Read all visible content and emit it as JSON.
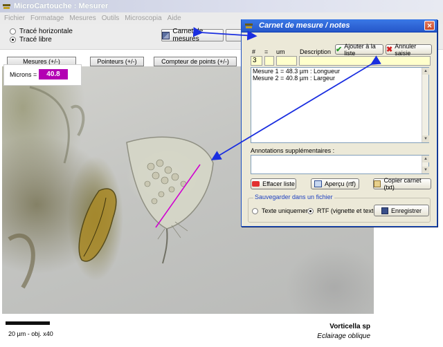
{
  "app": {
    "title": "MicroCartouche : Mesurer",
    "menu": [
      "Fichier",
      "Formatage",
      "Mesures",
      "Outils",
      "Microscopia",
      "Aide"
    ]
  },
  "toolbar": {
    "trace_horizontal": "Tracé horizontale",
    "trace_libre": "Tracé libre",
    "selected_mode": "trace_libre",
    "carnet_button": "Carnet de mesures"
  },
  "tabs": {
    "mesures": "Mesures (+/-)",
    "pointeurs": "Pointeurs (+/-)",
    "compteur": "Compteur de points (+/-)"
  },
  "measurement": {
    "label": "Microns =",
    "value": "40.8"
  },
  "image": {
    "scale_label": "20 µm - obj. x40",
    "species": "Vorticella sp",
    "lighting": "Eclairage oblique"
  },
  "dialog": {
    "title": "Carnet de mesure / notes",
    "headers": {
      "num": "#",
      "eq": "=",
      "unit": "um",
      "description": "Description"
    },
    "fields": {
      "num": "3",
      "eq": "",
      "unit": "",
      "description": ""
    },
    "add_button": "Ajouter à la liste",
    "cancel_button": "Annuler saisie",
    "entries": [
      "Mesure 1 = 48.3 µm : Longueur",
      "Mesure 2 = 40.8 µm : Largeur"
    ],
    "annotations_label": "Annotations supplémentaires :",
    "clear_button": "Effacer liste",
    "preview_button": "Aperçu (rtf)",
    "copy_button": "Copier carnet (txt)",
    "save_group_label": "Sauvegarder dans un fichier",
    "save_text_only": "Texte uniquement",
    "save_rtf": "RTF (vignette et texte)",
    "save_selected": "rtf",
    "save_button": "Enregistrer"
  },
  "colors": {
    "measure_highlight": "#b300b3",
    "annotation_arrow": "#1a2ee0",
    "dialog_title": "#2657c9",
    "input_fill": "#ffffcc"
  }
}
